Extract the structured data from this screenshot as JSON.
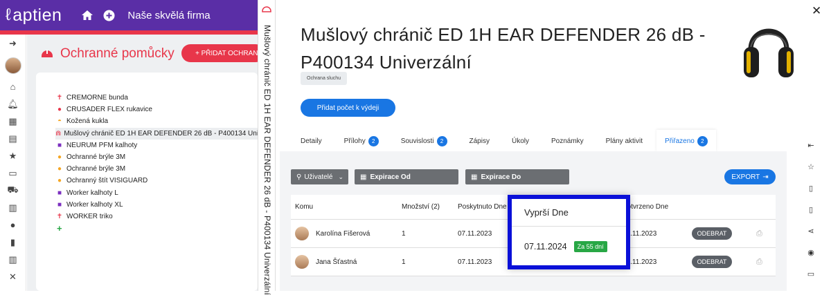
{
  "app": {
    "logo": "aptien",
    "company": "Naše skvělá firma",
    "colors": {
      "brand_purple": "#5a2ea6",
      "accent_red": "#e8364a",
      "primary_blue": "#1976e3",
      "success_green": "#28a745",
      "highlight_blue": "#0a10d8"
    }
  },
  "left_rail": {
    "icons": [
      "expand-icon",
      "avatar",
      "home-icon",
      "bell-icon",
      "calendar-icon",
      "clipboard-icon",
      "star-icon",
      "document-icon",
      "cart-icon",
      "report-icon",
      "user-icon",
      "building-icon",
      "books-icon",
      "tools-icon"
    ]
  },
  "background_page": {
    "title": "Ochranné pomůcky",
    "add_button": "+ PŘIDAT OCHRAN",
    "tree": [
      {
        "label": "CREMORNE bunda",
        "icon": "person-red"
      },
      {
        "label": "CRUSADER FLEX rukavice",
        "icon": "glove"
      },
      {
        "label": "Kožená kukla",
        "icon": "helmet"
      },
      {
        "label": "Mušlový chránič ED 1H EAR DEFENDER 26 dB - P400134 Univerzální",
        "icon": "earmuff",
        "selected": true
      },
      {
        "label": "NEURUM PFM kalhoty",
        "icon": "shirt-purple"
      },
      {
        "label": "Ochranné brýle 3M",
        "icon": "glasses"
      },
      {
        "label": "Ochranné brýle 3M",
        "icon": "glasses"
      },
      {
        "label": "Ochranný štít VISIGUARD",
        "icon": "glasses"
      },
      {
        "label": "Worker kalhoty L",
        "icon": "shirt-purple"
      },
      {
        "label": "Worker kalhoty XL",
        "icon": "shirt-purple"
      },
      {
        "label": "WORKER triko",
        "icon": "person-red"
      }
    ]
  },
  "vertical_strip": {
    "text": "Mušlový chránič ED 1H EAR DEFENDER 26 dB - P400134 Univerzální"
  },
  "detail": {
    "title_line1": "Mušlový chránič ED 1H EAR DEFENDER 26 dB -",
    "title_line2": "P400134 Univerzální",
    "tag": "Ochrana sluchu",
    "primary_button": "Přidat počet k výdeji",
    "tabs": [
      {
        "label": "Detaily",
        "badge": null
      },
      {
        "label": "Přílohy",
        "badge": "2"
      },
      {
        "label": "Souvislosti",
        "badge": "2"
      },
      {
        "label": "Zápisy",
        "badge": null
      },
      {
        "label": "Úkoly",
        "badge": null
      },
      {
        "label": "Poznámky",
        "badge": null
      },
      {
        "label": "Plány aktivit",
        "badge": null
      },
      {
        "label": "Přiřazeno",
        "badge": "2",
        "active": true
      }
    ],
    "filters": {
      "users": "Uživatelé",
      "exp_from": "Expirace Od",
      "exp_to": "Expirace Do"
    },
    "export_button": "EXPORT",
    "table": {
      "headers": {
        "to": "Komu",
        "qty": "Množství (2)",
        "provided": "Poskytnuto Dne",
        "confirmed": "Potvrzeno Dne"
      },
      "rows": [
        {
          "name": "Karolína Fišerová",
          "qty": "1",
          "provided": "07.11.2023",
          "confirmed": "07.11.2023",
          "action": "ODEBRAT"
        },
        {
          "name": "Jana Šťastná",
          "qty": "1",
          "provided": "07.11.2023",
          "confirmed": "07.11.2023",
          "action": "ODEBRAT"
        }
      ]
    },
    "highlight": {
      "header": "Vyprší Dne",
      "date": "07.11.2024",
      "days_badge": "Za 55 dní"
    }
  },
  "right_bar": {
    "icons": [
      "collapse-icon",
      "star-icon",
      "document-icon",
      "pdf-icon",
      "share-icon",
      "eye-icon",
      "card-icon"
    ]
  }
}
